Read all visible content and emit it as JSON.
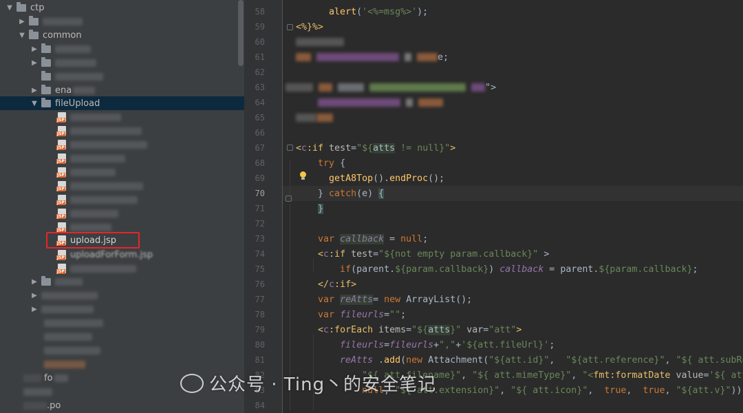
{
  "tree": {
    "root_label": "ctp",
    "common_label": "common",
    "partial_label_1": "ena",
    "selected_folder_label": "fileUpload",
    "highlighted_file_label": "upload.jsp",
    "partial_label_2": "uploadForForm.jsp",
    "partial_label_3": "fo",
    "partial_label_4": ".po"
  },
  "editor": {
    "line_numbers": [
      "58",
      "59",
      "60",
      "61",
      "62",
      "63",
      "64",
      "65",
      "66",
      "67",
      "68",
      "69",
      "70",
      "71",
      "72",
      "73",
      "74",
      "75",
      "76",
      "77",
      "78",
      "79",
      "80",
      "81",
      "82",
      "83",
      "84"
    ],
    "current_line": "70"
  },
  "watermark": {
    "text": "公众号 · Ting丶的安全笔记"
  },
  "icons": {
    "folder": "folder-icon",
    "jsp_file": "jsp-file-icon",
    "bulb": "intention-bulb-icon",
    "arrow": "chevron-icon"
  }
}
